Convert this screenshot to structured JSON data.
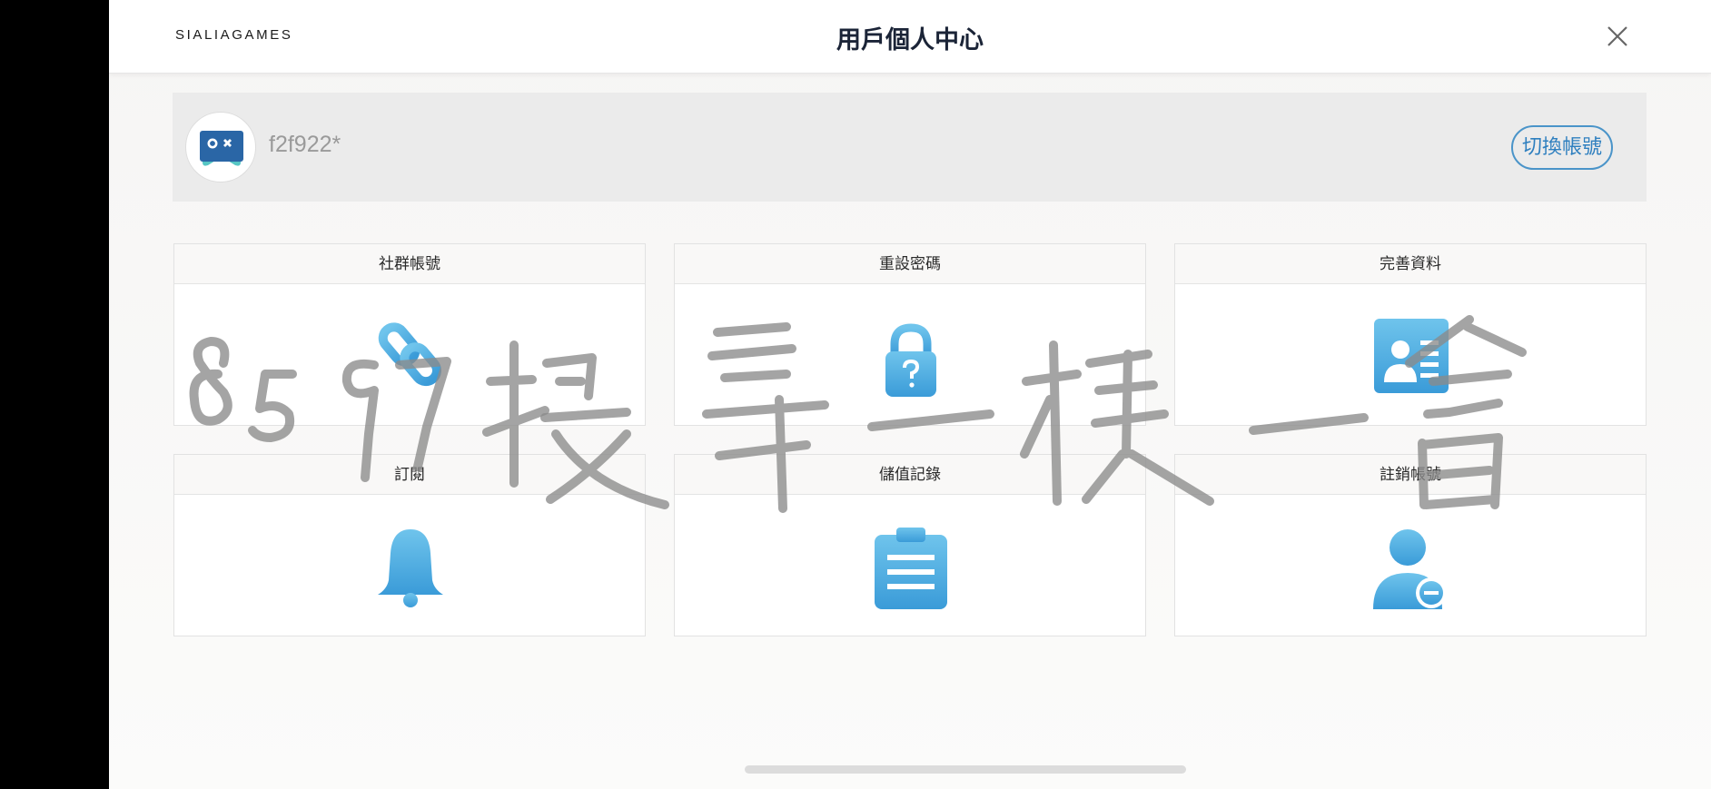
{
  "header": {
    "logo": "SIALIAGAMES",
    "title": "用戶個人中心",
    "close_icon": "close-icon"
  },
  "user": {
    "username": "f2f922*",
    "switch_account_label": "切換帳號",
    "avatar_icon": "game-controller-avatar-icon"
  },
  "cards": [
    {
      "label": "社群帳號",
      "icon": "link-icon"
    },
    {
      "label": "重設密碼",
      "icon": "lock-question-icon"
    },
    {
      "label": "完善資料",
      "icon": "id-card-icon"
    },
    {
      "label": "訂閱",
      "icon": "bell-icon"
    },
    {
      "label": "儲值記錄",
      "icon": "clipboard-icon"
    },
    {
      "label": "註銷帳號",
      "icon": "user-remove-icon"
    }
  ],
  "watermark": "8597搜尋一模一會",
  "colors": {
    "accent_blue": "#2e7fbf",
    "icon_gradient_top": "#6fc4ec",
    "icon_gradient_bottom": "#3a9bd8",
    "title_text": "#1b2437"
  }
}
